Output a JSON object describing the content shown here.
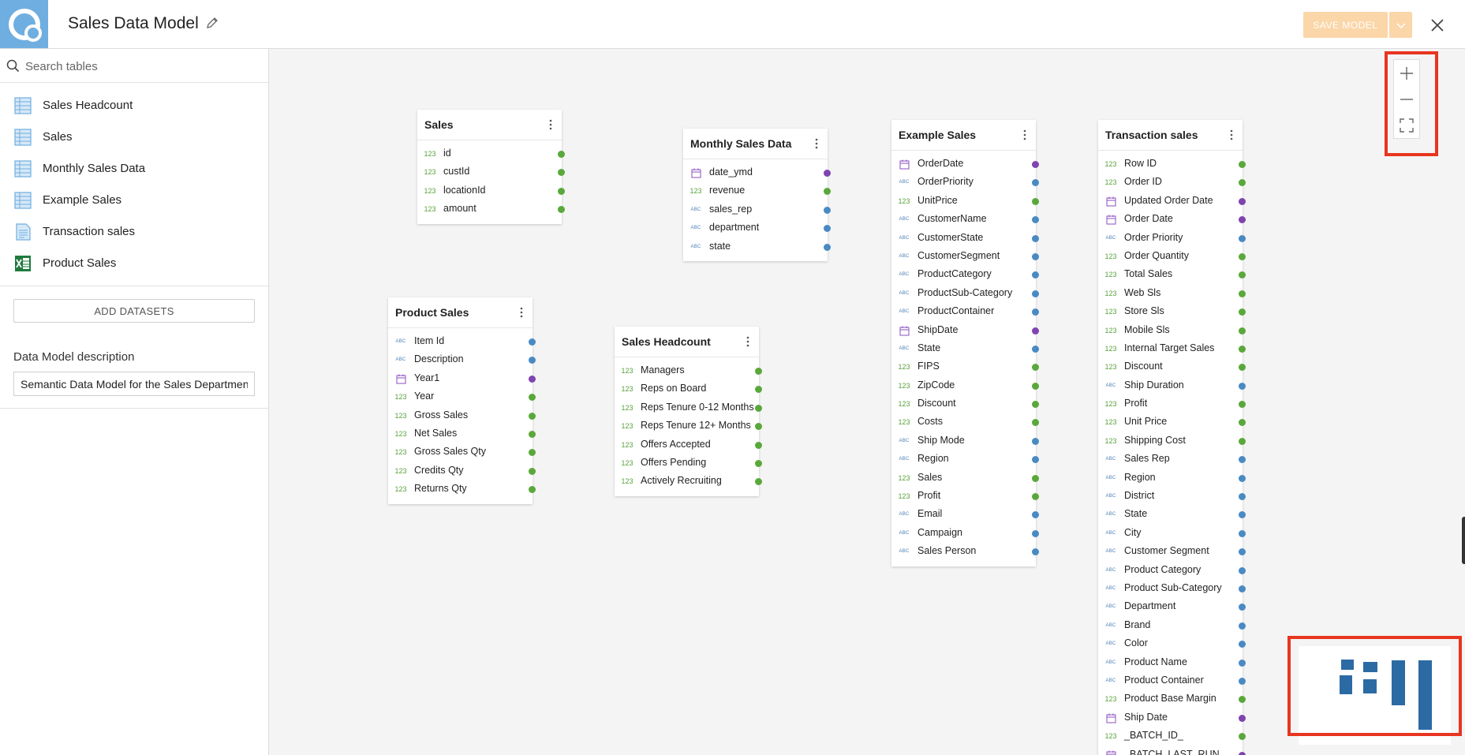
{
  "header": {
    "title": "Sales Data Model",
    "save_label": "SAVE MODEL"
  },
  "sidebar": {
    "search_placeholder": "Search tables",
    "datasets": [
      {
        "label": "Sales Headcount",
        "icon": "table-icon"
      },
      {
        "label": "Sales",
        "icon": "table-icon"
      },
      {
        "label": "Monthly Sales Data",
        "icon": "table-icon"
      },
      {
        "label": "Example Sales",
        "icon": "table-icon"
      },
      {
        "label": "Transaction sales",
        "icon": "document-icon"
      },
      {
        "label": "Product Sales",
        "icon": "excel-icon"
      }
    ],
    "add_datasets_label": "ADD DATASETS",
    "description_label": "Data Model description",
    "description_value": "Semantic Data Model for the Sales Department"
  },
  "cards": {
    "sales": {
      "title": "Sales",
      "fields": [
        {
          "name": "id",
          "type": "number"
        },
        {
          "name": "custId",
          "type": "number"
        },
        {
          "name": "locationId",
          "type": "number"
        },
        {
          "name": "amount",
          "type": "number"
        }
      ]
    },
    "monthly": {
      "title": "Monthly Sales Data",
      "fields": [
        {
          "name": "date_ymd",
          "type": "date"
        },
        {
          "name": "revenue",
          "type": "number"
        },
        {
          "name": "sales_rep",
          "type": "text"
        },
        {
          "name": "department",
          "type": "text"
        },
        {
          "name": "state",
          "type": "text"
        }
      ]
    },
    "example": {
      "title": "Example Sales",
      "fields": [
        {
          "name": "OrderDate",
          "type": "date"
        },
        {
          "name": "OrderPriority",
          "type": "text"
        },
        {
          "name": "UnitPrice",
          "type": "number"
        },
        {
          "name": "CustomerName",
          "type": "text"
        },
        {
          "name": "CustomerState",
          "type": "text"
        },
        {
          "name": "CustomerSegment",
          "type": "text"
        },
        {
          "name": "ProductCategory",
          "type": "text"
        },
        {
          "name": "ProductSub-Category",
          "type": "text"
        },
        {
          "name": "ProductContainer",
          "type": "text"
        },
        {
          "name": "ShipDate",
          "type": "date"
        },
        {
          "name": "State",
          "type": "text"
        },
        {
          "name": "FIPS",
          "type": "number"
        },
        {
          "name": "ZipCode",
          "type": "number"
        },
        {
          "name": "Discount",
          "type": "number"
        },
        {
          "name": "Costs",
          "type": "number"
        },
        {
          "name": "Ship Mode",
          "type": "text"
        },
        {
          "name": "Region",
          "type": "text"
        },
        {
          "name": "Sales",
          "type": "number"
        },
        {
          "name": "Profit",
          "type": "number"
        },
        {
          "name": "Email",
          "type": "text"
        },
        {
          "name": "Campaign",
          "type": "text"
        },
        {
          "name": "Sales Person",
          "type": "text"
        }
      ]
    },
    "transaction": {
      "title": "Transaction sales",
      "fields": [
        {
          "name": "Row ID",
          "type": "number"
        },
        {
          "name": "Order ID",
          "type": "number"
        },
        {
          "name": "Updated Order Date",
          "type": "date"
        },
        {
          "name": "Order Date",
          "type": "date"
        },
        {
          "name": "Order Priority",
          "type": "text"
        },
        {
          "name": "Order Quantity",
          "type": "number"
        },
        {
          "name": "Total Sales",
          "type": "number"
        },
        {
          "name": "Web Sls",
          "type": "number"
        },
        {
          "name": "Store Sls",
          "type": "number"
        },
        {
          "name": "Mobile Sls",
          "type": "number"
        },
        {
          "name": "Internal Target Sales",
          "type": "number"
        },
        {
          "name": "Discount",
          "type": "number"
        },
        {
          "name": "Ship Duration",
          "type": "text"
        },
        {
          "name": "Profit",
          "type": "number"
        },
        {
          "name": "Unit Price",
          "type": "number"
        },
        {
          "name": "Shipping Cost",
          "type": "number"
        },
        {
          "name": "Sales Rep",
          "type": "text"
        },
        {
          "name": "Region",
          "type": "text"
        },
        {
          "name": "District",
          "type": "text"
        },
        {
          "name": "State",
          "type": "text"
        },
        {
          "name": "City",
          "type": "text"
        },
        {
          "name": "Customer Segment",
          "type": "text"
        },
        {
          "name": "Product Category",
          "type": "text"
        },
        {
          "name": "Product Sub-Category",
          "type": "text"
        },
        {
          "name": "Department",
          "type": "text"
        },
        {
          "name": "Brand",
          "type": "text"
        },
        {
          "name": "Color",
          "type": "text"
        },
        {
          "name": "Product Name",
          "type": "text"
        },
        {
          "name": "Product Container",
          "type": "text"
        },
        {
          "name": "Product Base Margin",
          "type": "number"
        },
        {
          "name": "Ship Date",
          "type": "date"
        },
        {
          "name": "_BATCH_ID_",
          "type": "number"
        },
        {
          "name": "_BATCH_LAST_RUN_",
          "type": "date"
        }
      ]
    },
    "product": {
      "title": "Product Sales",
      "fields": [
        {
          "name": "Item Id",
          "type": "text"
        },
        {
          "name": "Description",
          "type": "text"
        },
        {
          "name": "Year1",
          "type": "date"
        },
        {
          "name": "Year",
          "type": "number"
        },
        {
          "name": "Gross Sales",
          "type": "number"
        },
        {
          "name": "Net Sales",
          "type": "number"
        },
        {
          "name": "Gross Sales Qty",
          "type": "number"
        },
        {
          "name": "Credits Qty",
          "type": "number"
        },
        {
          "name": "Returns Qty",
          "type": "number"
        }
      ]
    },
    "headcount": {
      "title": "Sales Headcount",
      "fields": [
        {
          "name": "Managers",
          "type": "number"
        },
        {
          "name": "Reps on Board",
          "type": "number"
        },
        {
          "name": "Reps Tenure 0-12 Months",
          "type": "number"
        },
        {
          "name": "Reps Tenure 12+ Months",
          "type": "number"
        },
        {
          "name": "Offers Accepted",
          "type": "number"
        },
        {
          "name": "Offers Pending",
          "type": "number"
        },
        {
          "name": "Actively Recruiting",
          "type": "number"
        }
      ]
    }
  },
  "type_badges": {
    "number": "123",
    "text": "ABC"
  },
  "colors": {
    "number": "#5aa83b",
    "text": "#4a8ac4",
    "date": "#7e44b0",
    "accent": "#6faee0",
    "save_button": "#fbd6a8",
    "highlight": "#e8351f",
    "minimap_block": "#2c6aa4"
  }
}
